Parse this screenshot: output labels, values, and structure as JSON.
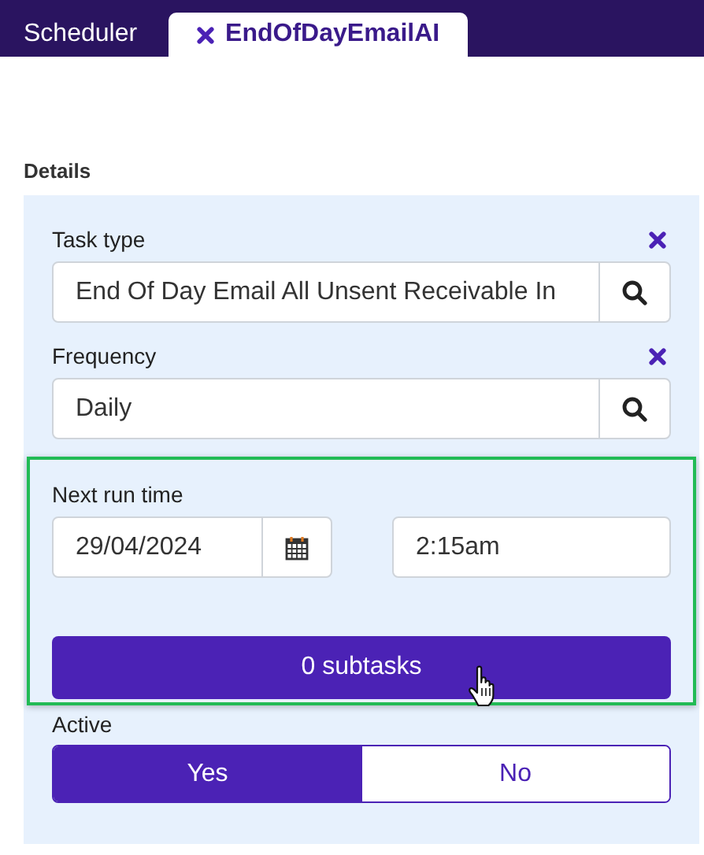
{
  "tabs": [
    {
      "label": "Scheduler",
      "selected": false,
      "closable": false
    },
    {
      "label": "EndOfDayEmailAI",
      "selected": true,
      "closable": true
    }
  ],
  "section_title": "Details",
  "fields": [
    {
      "kind": "lookup",
      "label": "Task type",
      "value": "End Of Day Email All Unsent Receivable In",
      "clearable": true
    },
    {
      "kind": "lookup",
      "label": "Frequency",
      "value": "Daily",
      "clearable": true
    }
  ],
  "next_run": {
    "label": "Next run time",
    "date": "29/04/2024",
    "time": "2:15am",
    "highlighted": true
  },
  "subtasks_button": "0 subtasks",
  "active": {
    "label": "Active",
    "options": [
      {
        "label": "Yes",
        "selected": true
      },
      {
        "label": "No",
        "selected": false
      }
    ]
  }
}
